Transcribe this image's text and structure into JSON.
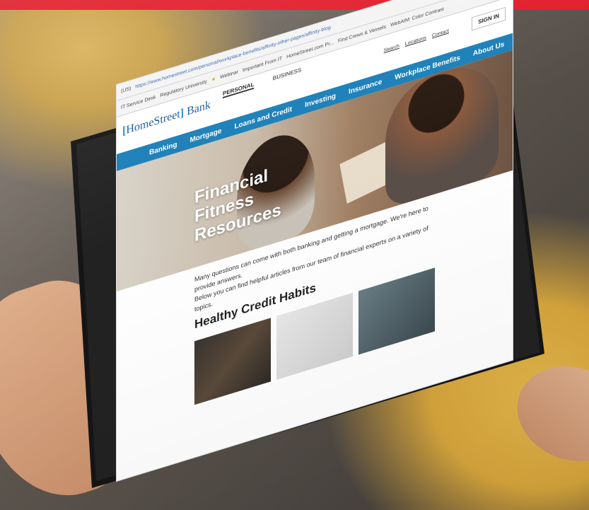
{
  "browser": {
    "tab_fragment": "(US)",
    "url": "https://www.homestreet.com/personal/workplace-benefits/affinity-other-pages/affinity-blog",
    "bookmarks": [
      "IT Service Desk",
      "Regulatory University",
      "Webinar",
      "Important From IT",
      "HomeStreet.com Pr...",
      "Find Crews & Vessels",
      "WebAIM: Color Contrast"
    ]
  },
  "site": {
    "logo": {
      "name": "HomeStreet",
      "suffix": "Bank"
    },
    "segments": {
      "personal": "PERSONAL",
      "business": "BUSINESS"
    },
    "utility": {
      "search": "Search",
      "locations": "Locations",
      "contact": "Contact"
    },
    "sign_in": "SIGN IN",
    "nav": [
      "Banking",
      "Mortgage",
      "Loans and Credit",
      "Investing",
      "Insurance",
      "Workplace Benefits",
      "About Us"
    ]
  },
  "hero": {
    "line1": "Financial",
    "line2": "Fitness",
    "line3": "Resources"
  },
  "content": {
    "intro_line1": "Many questions can come with both banking and getting a mortgage. We're here to provide answers.",
    "intro_line2": "Below you can find helpful articles from our team of financial experts on a variety of topics.",
    "section_heading": "Healthy Credit Habits"
  },
  "colors": {
    "brand_blue": "#1b7fb8",
    "top_bar": "#e11d2b"
  }
}
